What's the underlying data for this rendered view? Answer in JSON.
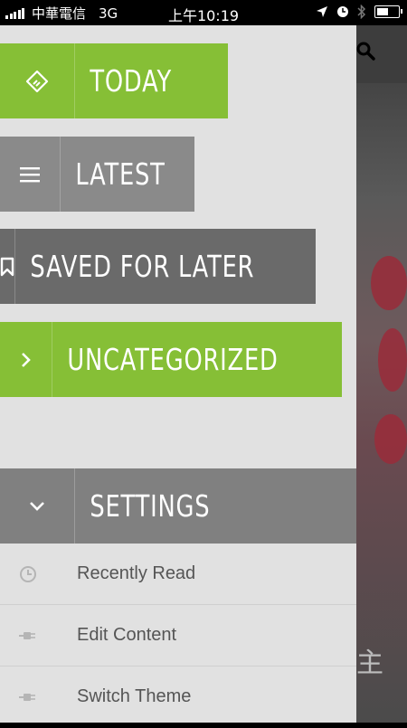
{
  "status_bar": {
    "carrier": "中華電信",
    "network": "3G",
    "time": "上午10:19"
  },
  "menu": {
    "today": "TODAY",
    "latest": "LATEST",
    "saved": "SAVED FOR LATER",
    "uncategorized": "UNCATEGORIZED",
    "settings": "SETTINGS"
  },
  "settings_items": {
    "recently_read": "Recently Read",
    "edit_content": "Edit Content",
    "switch_theme": "Switch Theme"
  },
  "background_char": "主",
  "colors": {
    "accent_green": "#86bf36",
    "drawer_bg": "#e1e1e1"
  },
  "icons": [
    "feedly-icon",
    "menu-lines-icon",
    "bookmark-icon",
    "chevron-right-icon",
    "chevron-down-icon",
    "clock-icon",
    "plug-icon",
    "search-icon",
    "location-icon",
    "alarm-icon",
    "bluetooth-icon",
    "battery-icon",
    "signal-icon"
  ]
}
